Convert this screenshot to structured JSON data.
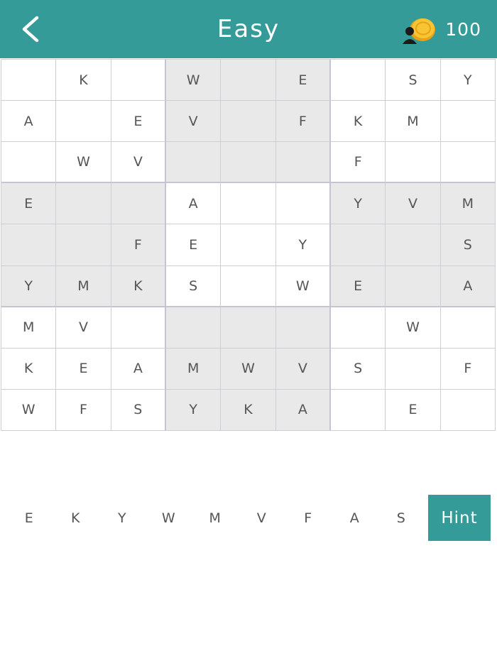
{
  "header": {
    "title": "Easy",
    "coins": "100",
    "back_icon": "chevron-left-icon",
    "coin_icon": "coin-stack-icon"
  },
  "colors": {
    "header_bg": "#349b98",
    "shaded_box": "#e9e9e9",
    "grid_line": "#cfcdd8",
    "cell_text": "#555555"
  },
  "board": {
    "rows": [
      [
        "",
        "K",
        "",
        "W",
        "",
        "E",
        "",
        "S",
        "Y"
      ],
      [
        "A",
        "",
        "E",
        "V",
        "",
        "F",
        "K",
        "M",
        ""
      ],
      [
        "",
        "W",
        "V",
        "",
        "",
        "",
        "F",
        "",
        ""
      ],
      [
        "E",
        "",
        "",
        "A",
        "",
        "",
        "Y",
        "V",
        "M"
      ],
      [
        "",
        "",
        "F",
        "E",
        "",
        "Y",
        "",
        "",
        "S"
      ],
      [
        "Y",
        "M",
        "K",
        "S",
        "",
        "W",
        "E",
        "",
        "A"
      ],
      [
        "M",
        "V",
        "",
        "",
        "",
        "",
        "",
        "W",
        ""
      ],
      [
        "K",
        "E",
        "A",
        "M",
        "W",
        "V",
        "S",
        "",
        "F"
      ],
      [
        "W",
        "F",
        "S",
        "Y",
        "K",
        "A",
        "",
        "E",
        ""
      ]
    ]
  },
  "letters": [
    "E",
    "K",
    "Y",
    "W",
    "M",
    "V",
    "F",
    "A",
    "S"
  ],
  "hint_label": "Hint"
}
